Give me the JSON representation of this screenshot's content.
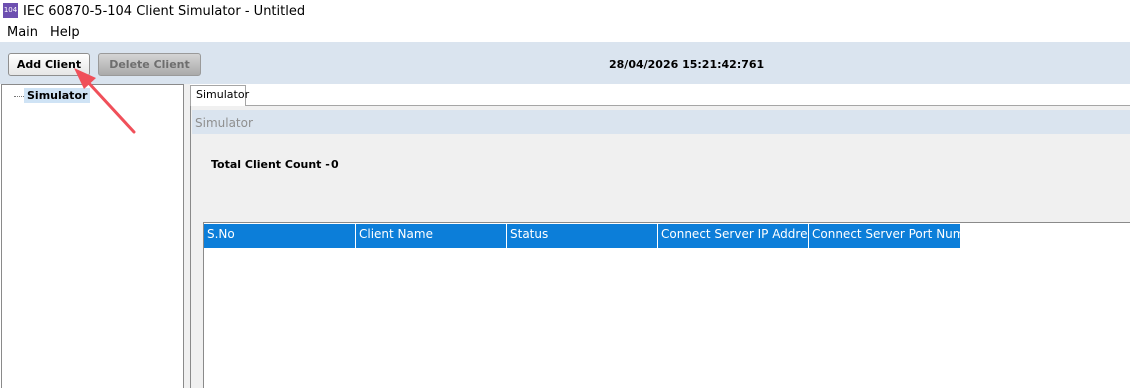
{
  "window": {
    "icon_text": "104",
    "title": "IEC 60870-5-104 Client Simulator - Untitled"
  },
  "menu": {
    "items": [
      "Main",
      "Help"
    ]
  },
  "toolbar": {
    "add_label": "Add Client",
    "delete_label": "Delete Client",
    "datetime": "28/04/2026 15:21:42:761"
  },
  "tree": {
    "root_label": "Simulator"
  },
  "tabs": {
    "active_label": "Simulator"
  },
  "panel": {
    "title": "Simulator",
    "count_label": "Total Client Count -",
    "count_value": "0"
  },
  "grid": {
    "columns": [
      "S.No",
      "Client Name",
      "Status",
      "Connect Server IP Address",
      "Connect Server Port Numb"
    ],
    "rows": []
  },
  "colors": {
    "toolbar_bg": "#dae4ef",
    "header_bg": "#0c7ed9",
    "selection_bg": "#cfe3f5",
    "annotation_arrow": "#f0505a"
  }
}
